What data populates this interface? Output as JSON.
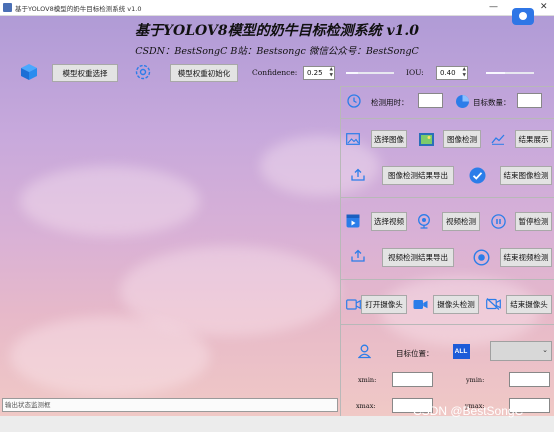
{
  "window": {
    "title": "基于YOLOV8模型的奶牛目标检测系统 v1.0",
    "minimize": "—",
    "close": "✕"
  },
  "header": {
    "title": "基于YOLOV8模型的奶牛目标检测系统 v1.0",
    "credits": "CSDN：BestSongC   B站：Bestsongc   微信公众号：BestSongC"
  },
  "toolbar": {
    "select_weights": "模型权重选择",
    "init_weights": "模型权重初始化",
    "confidence_label": "Confidence:",
    "confidence_value": "0.25",
    "confidence_level": 0.25,
    "iou_label": "IOU:",
    "iou_value": "0.40",
    "iou_level": 0.4
  },
  "stats": {
    "time_label": "检测用时：",
    "time_value": "",
    "count_label": "目标数量：",
    "count_value": ""
  },
  "image": {
    "select": "选择图像",
    "detect": "图像检测",
    "show_result": "结果展示",
    "export": "图像检测结果导出",
    "end": "结束图像检测"
  },
  "video": {
    "select": "选择视频",
    "detect": "视频检测",
    "pause": "暂停检测",
    "export": "视频检测结果导出",
    "end": "结束视频检测"
  },
  "camera": {
    "open": "打开摄像头",
    "detect": "摄像头检测",
    "close": "结束摄像头"
  },
  "target": {
    "position_label": "目标位置：",
    "all_badge": "ALL",
    "select_value": "",
    "xmin_label": "xmin:",
    "xmin_value": "",
    "ymin_label": "ymin:",
    "ymin_value": "",
    "xmax_label": "xmax:",
    "xmax_value": "",
    "ymax_label": "ymax:",
    "ymax_value": ""
  },
  "status": {
    "placeholder": "输出状态监测框"
  },
  "watermark": "CSDN @BestSongC",
  "colors": {
    "accent_blue": "#2b7de9",
    "background_top": "#b09bd6",
    "background_bottom": "#f0c9c6"
  },
  "icons": [
    "cube-icon",
    "gear-icon",
    "clock-icon",
    "pie-chart-icon",
    "image-icon",
    "gallery-icon",
    "trend-icon",
    "upload-icon",
    "check-circle-icon",
    "video-window-icon",
    "webcam-icon",
    "pause-icon",
    "record-icon",
    "camera-icon",
    "camera-off-icon",
    "person-location-icon"
  ]
}
